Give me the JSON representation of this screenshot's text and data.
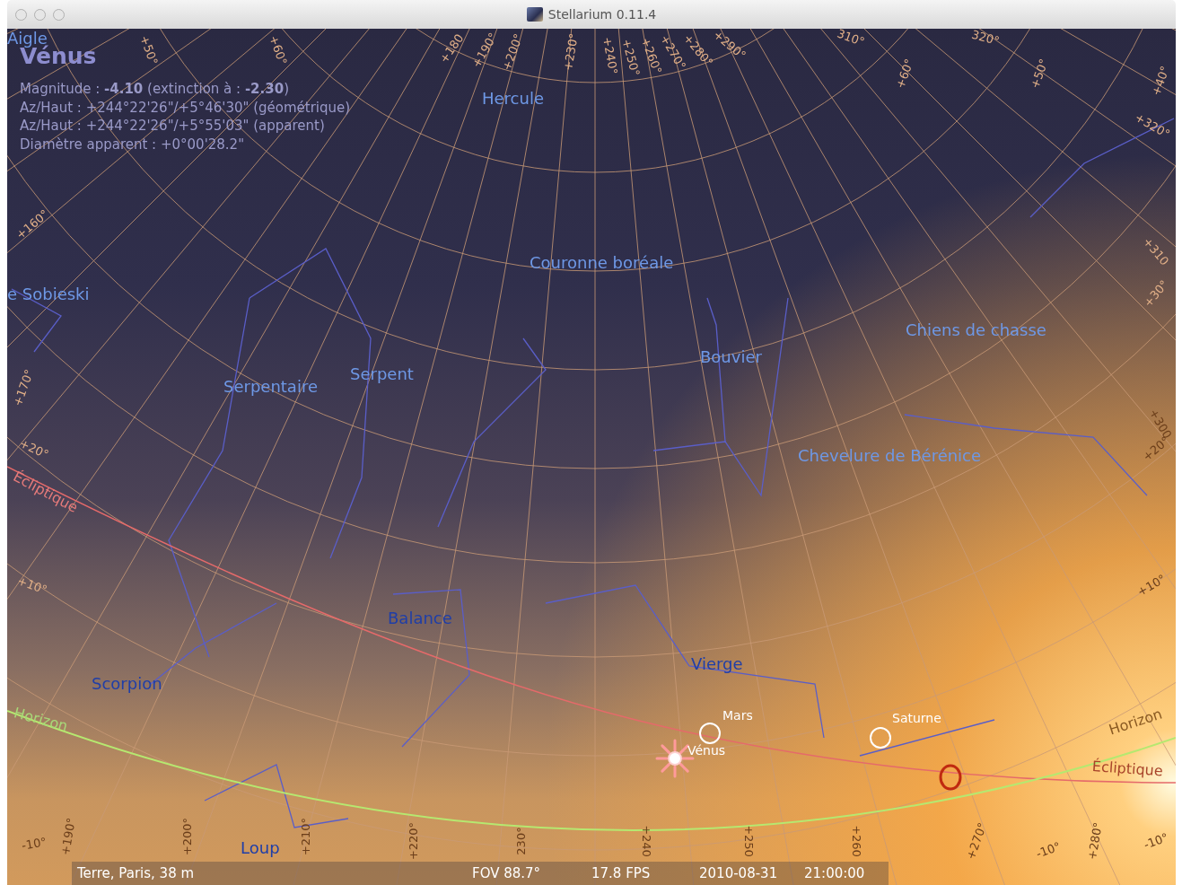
{
  "window": {
    "title": "Stellarium 0.11.4"
  },
  "object_info": {
    "name": "Vénus",
    "lines": [
      "Magnitude : **-4.10** (extinction à : **-2.30**)",
      "Az/Haut : +244°22'26\"/+5°46'30\" (géométrique)",
      "Az/Haut : +244°22'26\"/+5°55'03\" (apparent)",
      "Diamètre apparent : +0°00'28.2\""
    ]
  },
  "constellations": [
    "Aigle",
    "Hercule",
    "Couronne boréale",
    "e Sobieski",
    "Chiens de chasse",
    "Bouvier",
    "Serpent",
    "Serpentaire",
    "Chevelure de Bérénice",
    "Balance",
    "Vierge",
    "Scorpion",
    "Loup"
  ],
  "grid_labels": [
    "+50°",
    "+60°",
    "+180",
    "+190°",
    "+200°",
    "+230°",
    "+240°",
    "+250°",
    "+260°",
    "+270°",
    "+280°",
    "+290°",
    "310°",
    "+60°",
    "320°",
    "+50°",
    "+40°",
    "+320°",
    "+160°",
    "+310",
    "+30°",
    "+170°",
    "+300",
    "+20°",
    "+20°",
    "+10°",
    "+10°",
    "-10°",
    "+190°",
    "+200°",
    "+210°",
    "+220°",
    "230°",
    "+240",
    "+250",
    "+260",
    "+270°",
    "-10°",
    "+280°",
    "-10°"
  ],
  "line_labels": [
    {
      "kind": "ecliptic",
      "text": "Écliptique"
    },
    {
      "kind": "horizon",
      "text": "Horizon"
    },
    {
      "kind": "horizon",
      "text": "Horizon"
    },
    {
      "kind": "ecliptic",
      "text": "Écliptique"
    }
  ],
  "planets": [
    {
      "name": "Mars",
      "kind": "circle"
    },
    {
      "name": "Vénus",
      "kind": "glare"
    },
    {
      "name": "Saturne",
      "kind": "circle"
    }
  ],
  "status_bar": {
    "location": "Terre, Paris, 38 m",
    "fov": "FOV 88.7°",
    "fps": "17.8 FPS",
    "date": "2010-08-31",
    "time": "21:00:00"
  }
}
